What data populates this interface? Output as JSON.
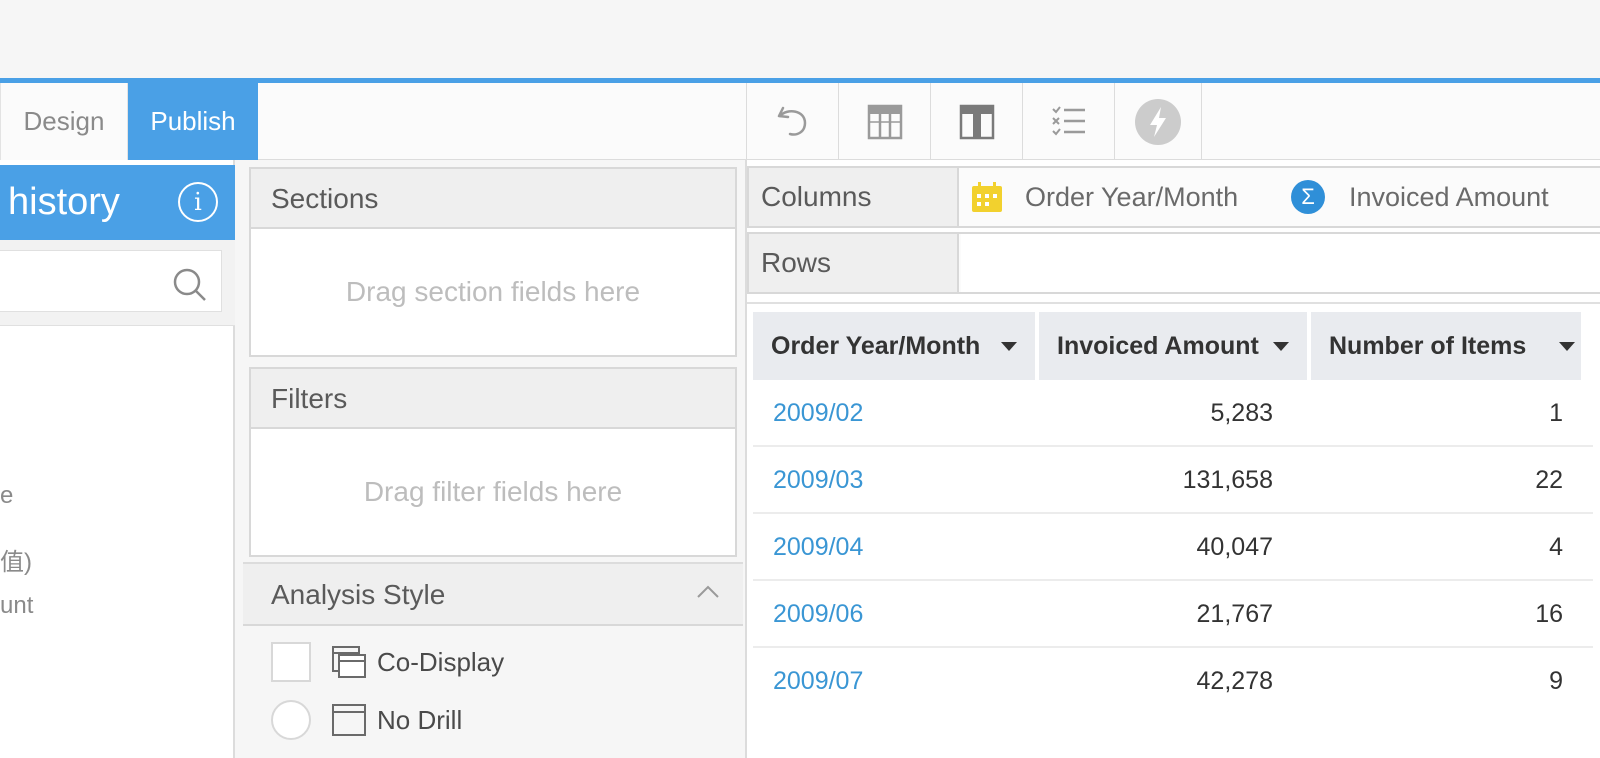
{
  "toolbar": {
    "tabs": [
      {
        "label": "Design"
      },
      {
        "label": "Publish"
      }
    ],
    "tools": [
      {
        "icon": "undo-icon"
      },
      {
        "icon": "table-columns-icon"
      },
      {
        "icon": "table-layout-icon"
      },
      {
        "icon": "checklist-icon"
      },
      {
        "icon": "lightning-icon"
      }
    ]
  },
  "left_panel": {
    "title": "history",
    "items": [
      {
        "label": "e"
      },
      {
        "label": "值)"
      },
      {
        "label": "unt"
      }
    ]
  },
  "sections": {
    "title": "Sections",
    "placeholder": "Drag section fields here"
  },
  "filters": {
    "title": "Filters",
    "placeholder": "Drag filter fields here"
  },
  "analysis_style": {
    "title": "Analysis Style",
    "options": [
      {
        "label": "Co-Display"
      },
      {
        "label": "No Drill"
      }
    ]
  },
  "columns": {
    "label": "Columns",
    "fields": [
      {
        "label": "Order Year/Month",
        "icon": "calendar-icon"
      },
      {
        "label": "Invoiced Amount",
        "icon": "sigma-icon"
      }
    ]
  },
  "rows": {
    "label": "Rows"
  },
  "table": {
    "headers": [
      "Order Year/Month",
      "Invoiced Amount",
      "Number of Items"
    ],
    "rows": [
      {
        "month": "2009/02",
        "amount": "5,283",
        "items": "1"
      },
      {
        "month": "2009/03",
        "amount": "131,658",
        "items": "22"
      },
      {
        "month": "2009/04",
        "amount": "40,047",
        "items": "4"
      },
      {
        "month": "2009/06",
        "amount": "21,767",
        "items": "16"
      },
      {
        "month": "2009/07",
        "amount": "42,278",
        "items": "9"
      }
    ]
  },
  "colors": {
    "accent": "#4aa0e6",
    "link": "#3a96d4",
    "calendar": "#f2d12e",
    "sigma": "#2f8fd8"
  }
}
